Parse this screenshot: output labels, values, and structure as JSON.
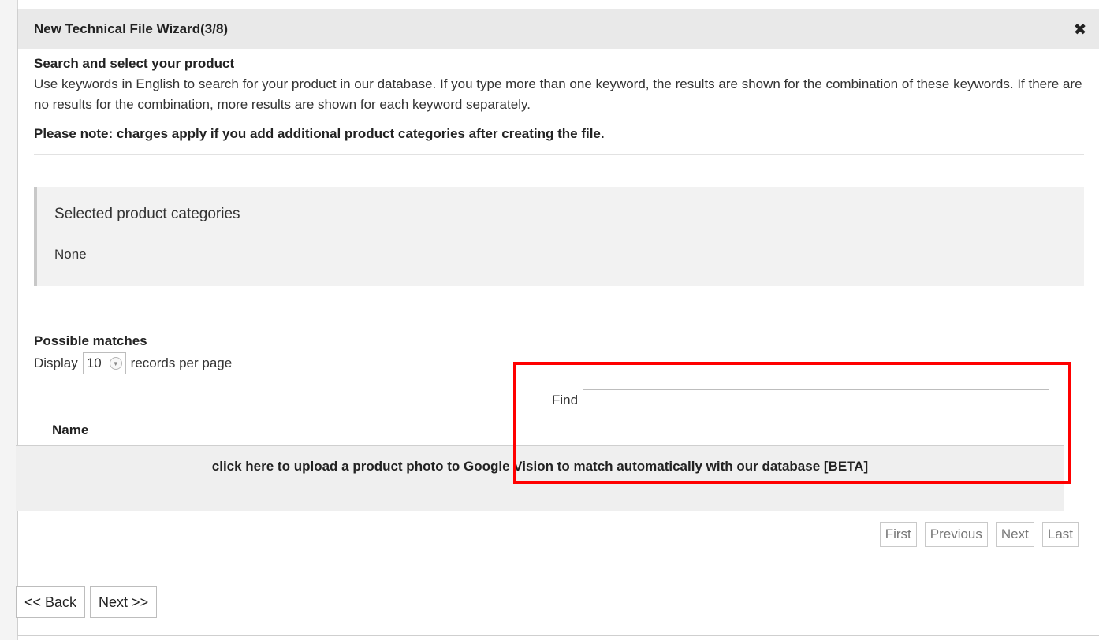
{
  "dialog": {
    "title": "New Technical File Wizard(3/8)",
    "close_icon": "close-icon"
  },
  "intro": {
    "heading": "Search and select your product",
    "description": "Use keywords in English to search for your product in our database. If you type more than one keyword, the results are shown for the combination of these keywords. If there are no results for the combination, more results are shown for each keyword separately.",
    "note": "Please note: charges apply if you add additional product categories after creating the file."
  },
  "selected": {
    "title": "Selected product categories",
    "value": "None"
  },
  "matches": {
    "title": "Possible matches",
    "display_prefix": "Display",
    "records_value": "10",
    "display_suffix": "records per page",
    "find_label": "Find",
    "find_value": "",
    "column_name": "Name",
    "upload_link": "click here to upload a product photo to Google Vision to match automatically with our database [BETA]"
  },
  "pager": {
    "first": "First",
    "previous": "Previous",
    "next": "Next",
    "last": "Last"
  },
  "nav": {
    "back": "<< Back",
    "next": "Next >>"
  },
  "colors": {
    "highlight": "#ff0000",
    "titlebar": "#e9e9e9"
  }
}
